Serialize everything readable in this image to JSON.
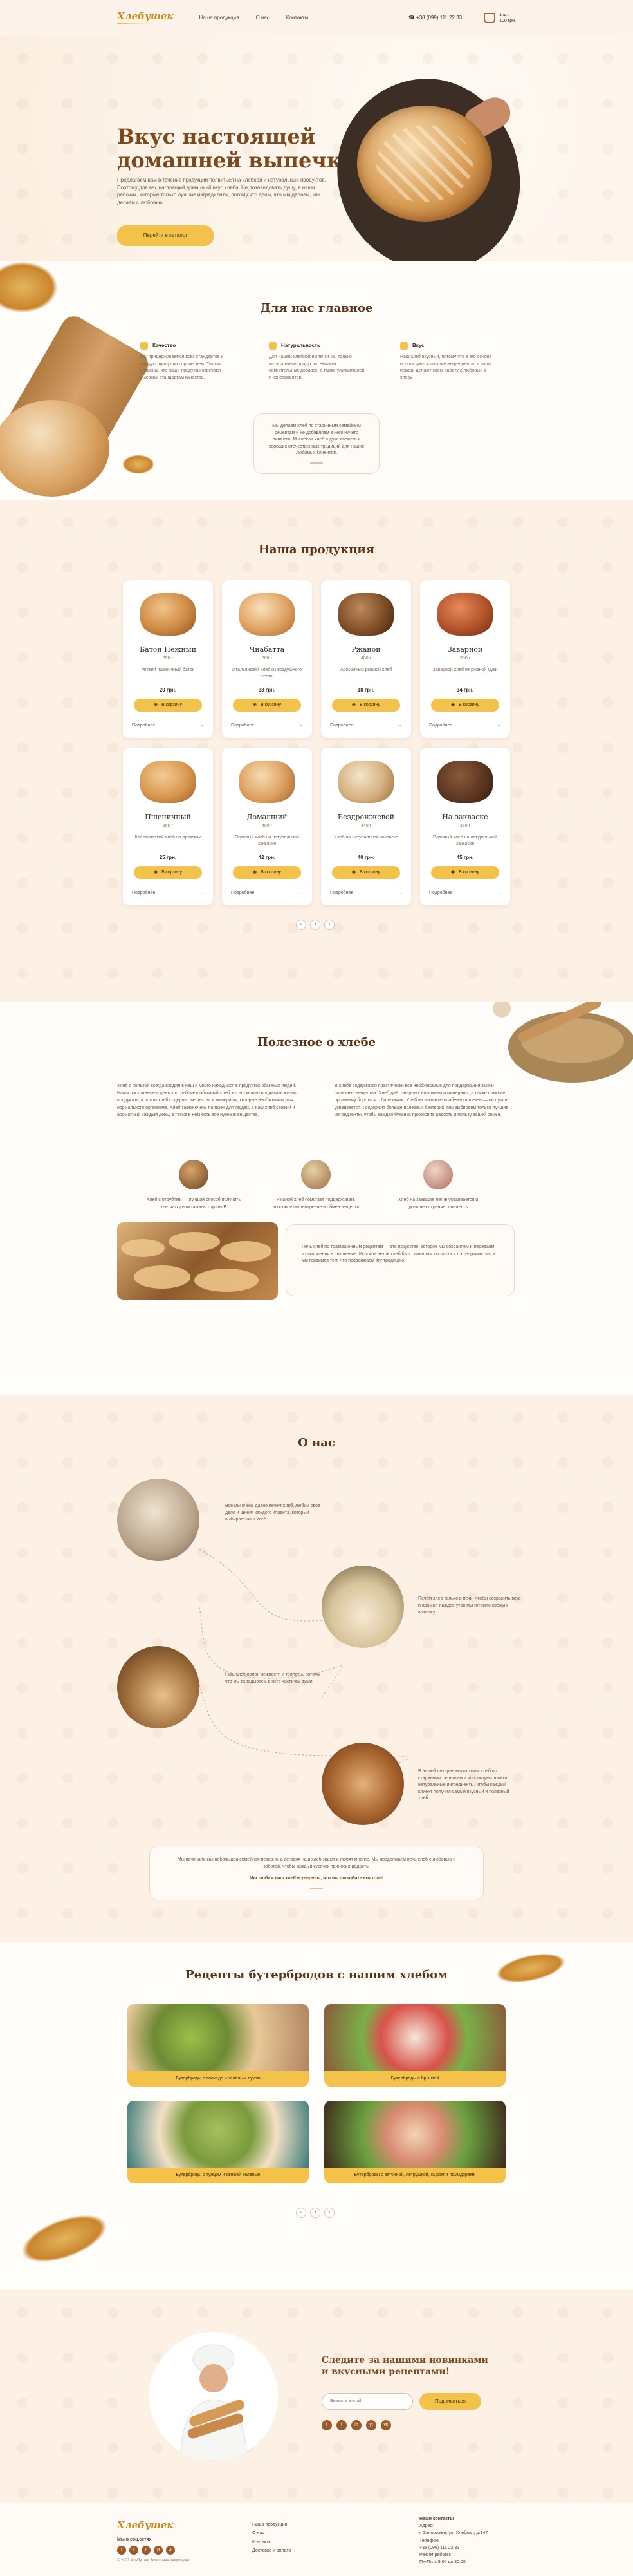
{
  "header": {
    "logo": "Хлебушек",
    "nav": [
      "Наша продукция",
      "О нас",
      "Контакты"
    ],
    "phone": "+38 (099) 111 22 33",
    "cart_count": "1 шт.",
    "cart_total": "100 грн."
  },
  "hero": {
    "title_line1": "Вкус настоящей",
    "title_line2": "домашней выпечки",
    "text": "Предлагаем вам в течение продукции появиться на хлебной и натуральных продуктов. Поэтому для вас настоящий домашний вкус хлеба. Не позавидовать душу, в наши рабочих, которые только лучшие ингредиенты, потому что едим, что мы делаем, мы делаем с любовью!",
    "button": "Перейти в каталог"
  },
  "values": {
    "title": "Для нас главное",
    "features": [
      {
        "title": "Качество",
        "text": "Мы придерживаемся всех стандартов и каждую продукцию проверяем. Так мы уверены, что наши продукты отвечают высоким стандартам качества."
      },
      {
        "title": "Натуральность",
        "text": "Для нашей хлебной выпечки мы только натуральные продукты. Никаких сомнительных добавок, а также улучшителей и консервантов."
      },
      {
        "title": "Вкус",
        "text": "Наш хлеб вкусный, потому что в его основе используются лучшие ингредиенты, а наши пекари делают свою работу с любовью к хлебу."
      }
    ],
    "quote": "Мы делаем хлеб по старинным семейным рецептам и не добавляем в него ничего лишнего. Мы пекли хлеб в духе свежего и хороших отечественных традиций для наших любимых клиентов."
  },
  "products": {
    "title": "Наша продукция",
    "items": [
      {
        "name": "Батон Нежный",
        "weight": "350 г",
        "desc": "Мягкий пшеничный батон",
        "price": "20 грн."
      },
      {
        "name": "Чиабатта",
        "weight": "300 г",
        "desc": "Итальянский хлеб из воздушного теста",
        "price": "38 грн."
      },
      {
        "name": "Ржаной",
        "weight": "400 г",
        "desc": "Ароматный ржаной хлеб",
        "price": "18 грн."
      },
      {
        "name": "Заварной",
        "weight": "300 г",
        "desc": "Заварной хлеб из ржаной муки",
        "price": "34 грн."
      },
      {
        "name": "Пшеничный",
        "weight": "350 г",
        "desc": "Классический хлеб на дрожжах",
        "price": "25 грн."
      },
      {
        "name": "Домашний",
        "weight": "400 г",
        "desc": "Подовый хлеб на натуральной закваске",
        "price": "42 грн."
      },
      {
        "name": "Бездрожжевой",
        "weight": "440 г",
        "desc": "Хлеб на натуральной закваске",
        "price": "40 грн."
      },
      {
        "name": "На закваске",
        "weight": "350 г",
        "desc": "Подовый хлеб на натуральной закваске",
        "price": "45 грн."
      }
    ],
    "buy_label": "В корзину",
    "more_label": "Подробнее"
  },
  "useful": {
    "title": "Полезное о хлебе",
    "col1": "Хлеб с пользой всегда входил в наш и много находился в продуктах обычных людей. Наши постоянные в день употребляем обычный хлеб, но его можно продавать жизнь продуктов, а потом хлеб содержит вещества и минералы, которые необходимы для нормального организма. Хлеб также очень полезен для людей, а наш хлеб свежий и ароматный каждый день, а также в нём есть все нужные вещества.",
    "col2": "В хлебе содержатся практически все необходимые для поддержания жизни полезные вещества. Хлеб даёт энергию, витамины и минералы, а также помогает организму бороться с болезнями. Хлеб на закваске особенно полезен — он лучше усваивается и содержит больше полезных бактерий. Мы выбираем только лучшие ингредиенты, чтобы каждая буханка приносила радость и пользу вашей семье.",
    "minis": [
      "Хлеб с отрубями — лучший способ получить клетчатку и витамины группы B",
      "Ржаной хлеб помогает поддерживать здоровое пищеварение и обмен веществ",
      "Хлеб на закваске легче усваивается и дольше сохраняет свежесть"
    ],
    "quote": "Печь хлеб по традиционным рецептам — это искусство, которое мы сохраняем и передаём из поколения в поколение. Испокон веков хлеб был символом достатка и гостеприимства, и мы гордимся тем, что продолжаем эту традицию."
  },
  "about": {
    "title": "О нас",
    "items": [
      "Все мы очень давно печём хлеб, любим своё дело и ценим каждого клиента, который выбирает наш хлеб.",
      "Печём хлеб только в печи, чтобы сохранить вкус и аромат. Каждое утро мы готовим свежую выпечку.",
      "Наш хлеб полон нежности и теплоты, потому что мы вкладываем в него частичку души.",
      "В нашей пекарне мы готовим хлеб по старинным рецептам и используем только натуральные ингредиенты, чтобы каждый клиент получил самый вкусный и полезный хлеб."
    ],
    "quote": "Мы начинали как небольшая семейная пекарня, а сегодня наш хлеб знают и любят многие. Мы продолжаем печь хлеб с любовью и заботой, чтобы каждый кусочек приносил радость.",
    "quote_end": "Мы любим наш хлеб и уверены, что вы полюбите его тоже!"
  },
  "recipes": {
    "title": "Рецепты бутербродов с нашим хлебом",
    "items": [
      "Бутерброды с авокадо и зелёным луком",
      "Бутерброды с брынзой",
      "Бутерброды с тунцом и свежей зеленью",
      "Бутерброды с ветчиной, петрушкой, сыром и помидорами"
    ]
  },
  "subscribe": {
    "title_line1": "Следите за нашими новинками",
    "title_line2": "и вкусными рецептами!",
    "placeholder": "Введите e-mail",
    "button": "Подписаться",
    "socials": [
      "f",
      "t",
      "in",
      "yt",
      "vk"
    ]
  },
  "footer": {
    "logo": "Хлебушек",
    "social_label": "Мы в соц.сетях",
    "copyright": "© 2021 Хлебушек. Все права защищены",
    "links": [
      "Наша продукция",
      "О нас",
      "Контакты",
      "Доставка и оплата"
    ],
    "contacts_title": "Наши контакты",
    "address_label": "Адрес:",
    "address": "г. Запорожье, ул. Хлебная, д.147",
    "phone_label": "Телефон:",
    "phone": "+38 (099) 111 22 33",
    "hours_label": "Режим работы:",
    "hours": "Пн-Пт: с 9:00 до 20:00"
  }
}
